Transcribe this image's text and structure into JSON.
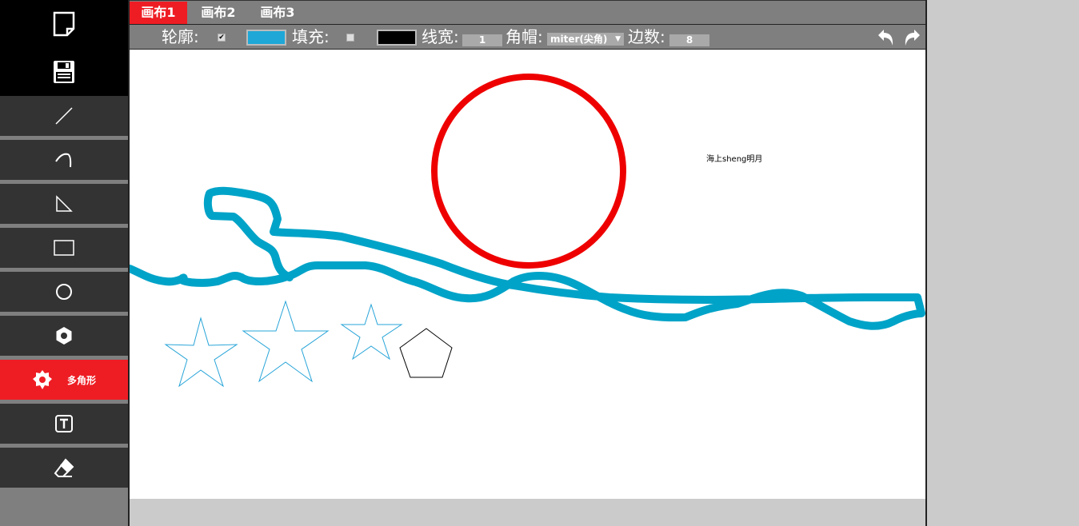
{
  "sidebar": {
    "top_icons": [
      {
        "name": "new-file-icon"
      },
      {
        "name": "save-icon"
      }
    ],
    "tools": [
      {
        "name": "line-icon",
        "label": ""
      },
      {
        "name": "curve-icon",
        "label": ""
      },
      {
        "name": "triangle-icon",
        "label": ""
      },
      {
        "name": "rectangle-icon",
        "label": ""
      },
      {
        "name": "circle-icon",
        "label": ""
      },
      {
        "name": "hexagon-icon",
        "label": ""
      },
      {
        "name": "polygon-icon",
        "label": "多角形",
        "active": true
      },
      {
        "name": "text-icon",
        "label": ""
      },
      {
        "name": "eraser-icon",
        "label": ""
      }
    ]
  },
  "tabs": [
    {
      "label": "画布1",
      "active": true
    },
    {
      "label": "画布2",
      "active": false
    },
    {
      "label": "画布3",
      "active": false
    }
  ],
  "toolbar": {
    "outline_label": "轮廓:",
    "outline_checked": true,
    "outline_color": "#1ea7d7",
    "fill_label": "填充:",
    "fill_checked": false,
    "fill_color": "#000000",
    "line_width_label": "线宽:",
    "line_width_value": "1",
    "cap_label": "角帽:",
    "cap_value": "miter(尖角)",
    "sides_label": "边数:",
    "sides_value": "8",
    "undo_icon": "undo-icon",
    "redo_icon": "redo-icon"
  },
  "canvas": {
    "text": "海上sheng明月",
    "colors": {
      "red": "#ee0000",
      "blue": "#00a3c8",
      "star": "#27a4d8",
      "black": "#000000"
    }
  },
  "colors": {
    "accent": "#ee1d24",
    "sidebar_bg": "#333333",
    "toolbar_bg": "#7f7f7f"
  }
}
